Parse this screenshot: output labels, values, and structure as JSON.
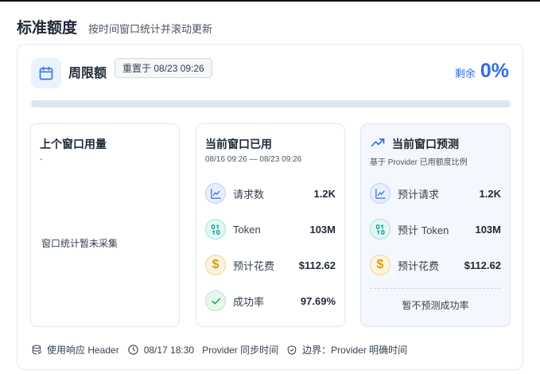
{
  "header": {
    "title": "标准额度",
    "subtitle": "按时间窗口统计并滚动更新"
  },
  "period": {
    "title": "周限额",
    "reset": "重置于 08/23 09:26",
    "remaining_label": "剩余",
    "remaining_value": "0%",
    "progress_fraction": 0.0
  },
  "previous": {
    "title": "上个窗口用量",
    "sub": "-",
    "empty_text": "窗口统计暂未采集"
  },
  "current": {
    "title": "当前窗口已用",
    "range": "08/16 09:26 — 08/23 09:26",
    "rows": [
      {
        "icon": "chart-icon",
        "label": "请求数",
        "value": "1.2K"
      },
      {
        "icon": "binary-icon",
        "label": "Token",
        "value": "103M"
      },
      {
        "icon": "dollar-icon",
        "label": "预计花费",
        "value": "$112.62"
      },
      {
        "icon": "check-icon",
        "label": "成功率",
        "value": "97.69%"
      }
    ]
  },
  "forecast": {
    "title": "当前窗口预测",
    "sub": "基于 Provider 已用额度比例",
    "rows": [
      {
        "icon": "chart-icon",
        "label": "预计请求",
        "value": "1.2K"
      },
      {
        "icon": "binary-icon",
        "label": "预计 Token",
        "value": "103M"
      },
      {
        "icon": "dollar-icon",
        "label": "预计花费",
        "value": "$112.62"
      }
    ],
    "no_prediction": "暂不预测成功率"
  },
  "footer": {
    "source": "使用响应 Header",
    "sync_time": "08/17 18:30",
    "sync_label": "Provider 同步时间",
    "boundary": "边界：Provider 明确时间"
  },
  "colors": {
    "accent": "#2f6fe0",
    "track": "#dde5ef"
  }
}
